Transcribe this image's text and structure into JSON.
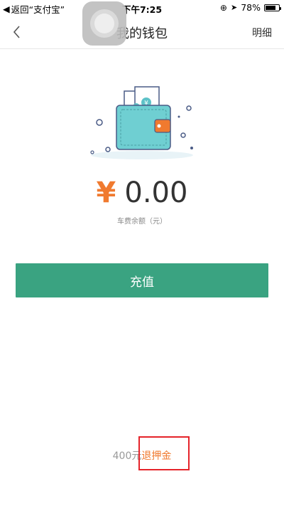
{
  "status_bar": {
    "back_label": "返回“支付宝”",
    "time": "下午7:25",
    "battery": "78%",
    "battery_level": 0.78
  },
  "nav": {
    "title": "我的钱包",
    "detail_label": "明细"
  },
  "wallet": {
    "currency_symbol": "¥",
    "balance": "0.00",
    "balance_label": "车费余额（元）",
    "illustration_currency": "¥"
  },
  "actions": {
    "recharge_label": "充值"
  },
  "deposit": {
    "amount": "400元",
    "refund_label": "退押金"
  },
  "colors": {
    "primary_green": "#3aa381",
    "accent_orange": "#f07a2f",
    "highlight_red": "#e5232a"
  }
}
